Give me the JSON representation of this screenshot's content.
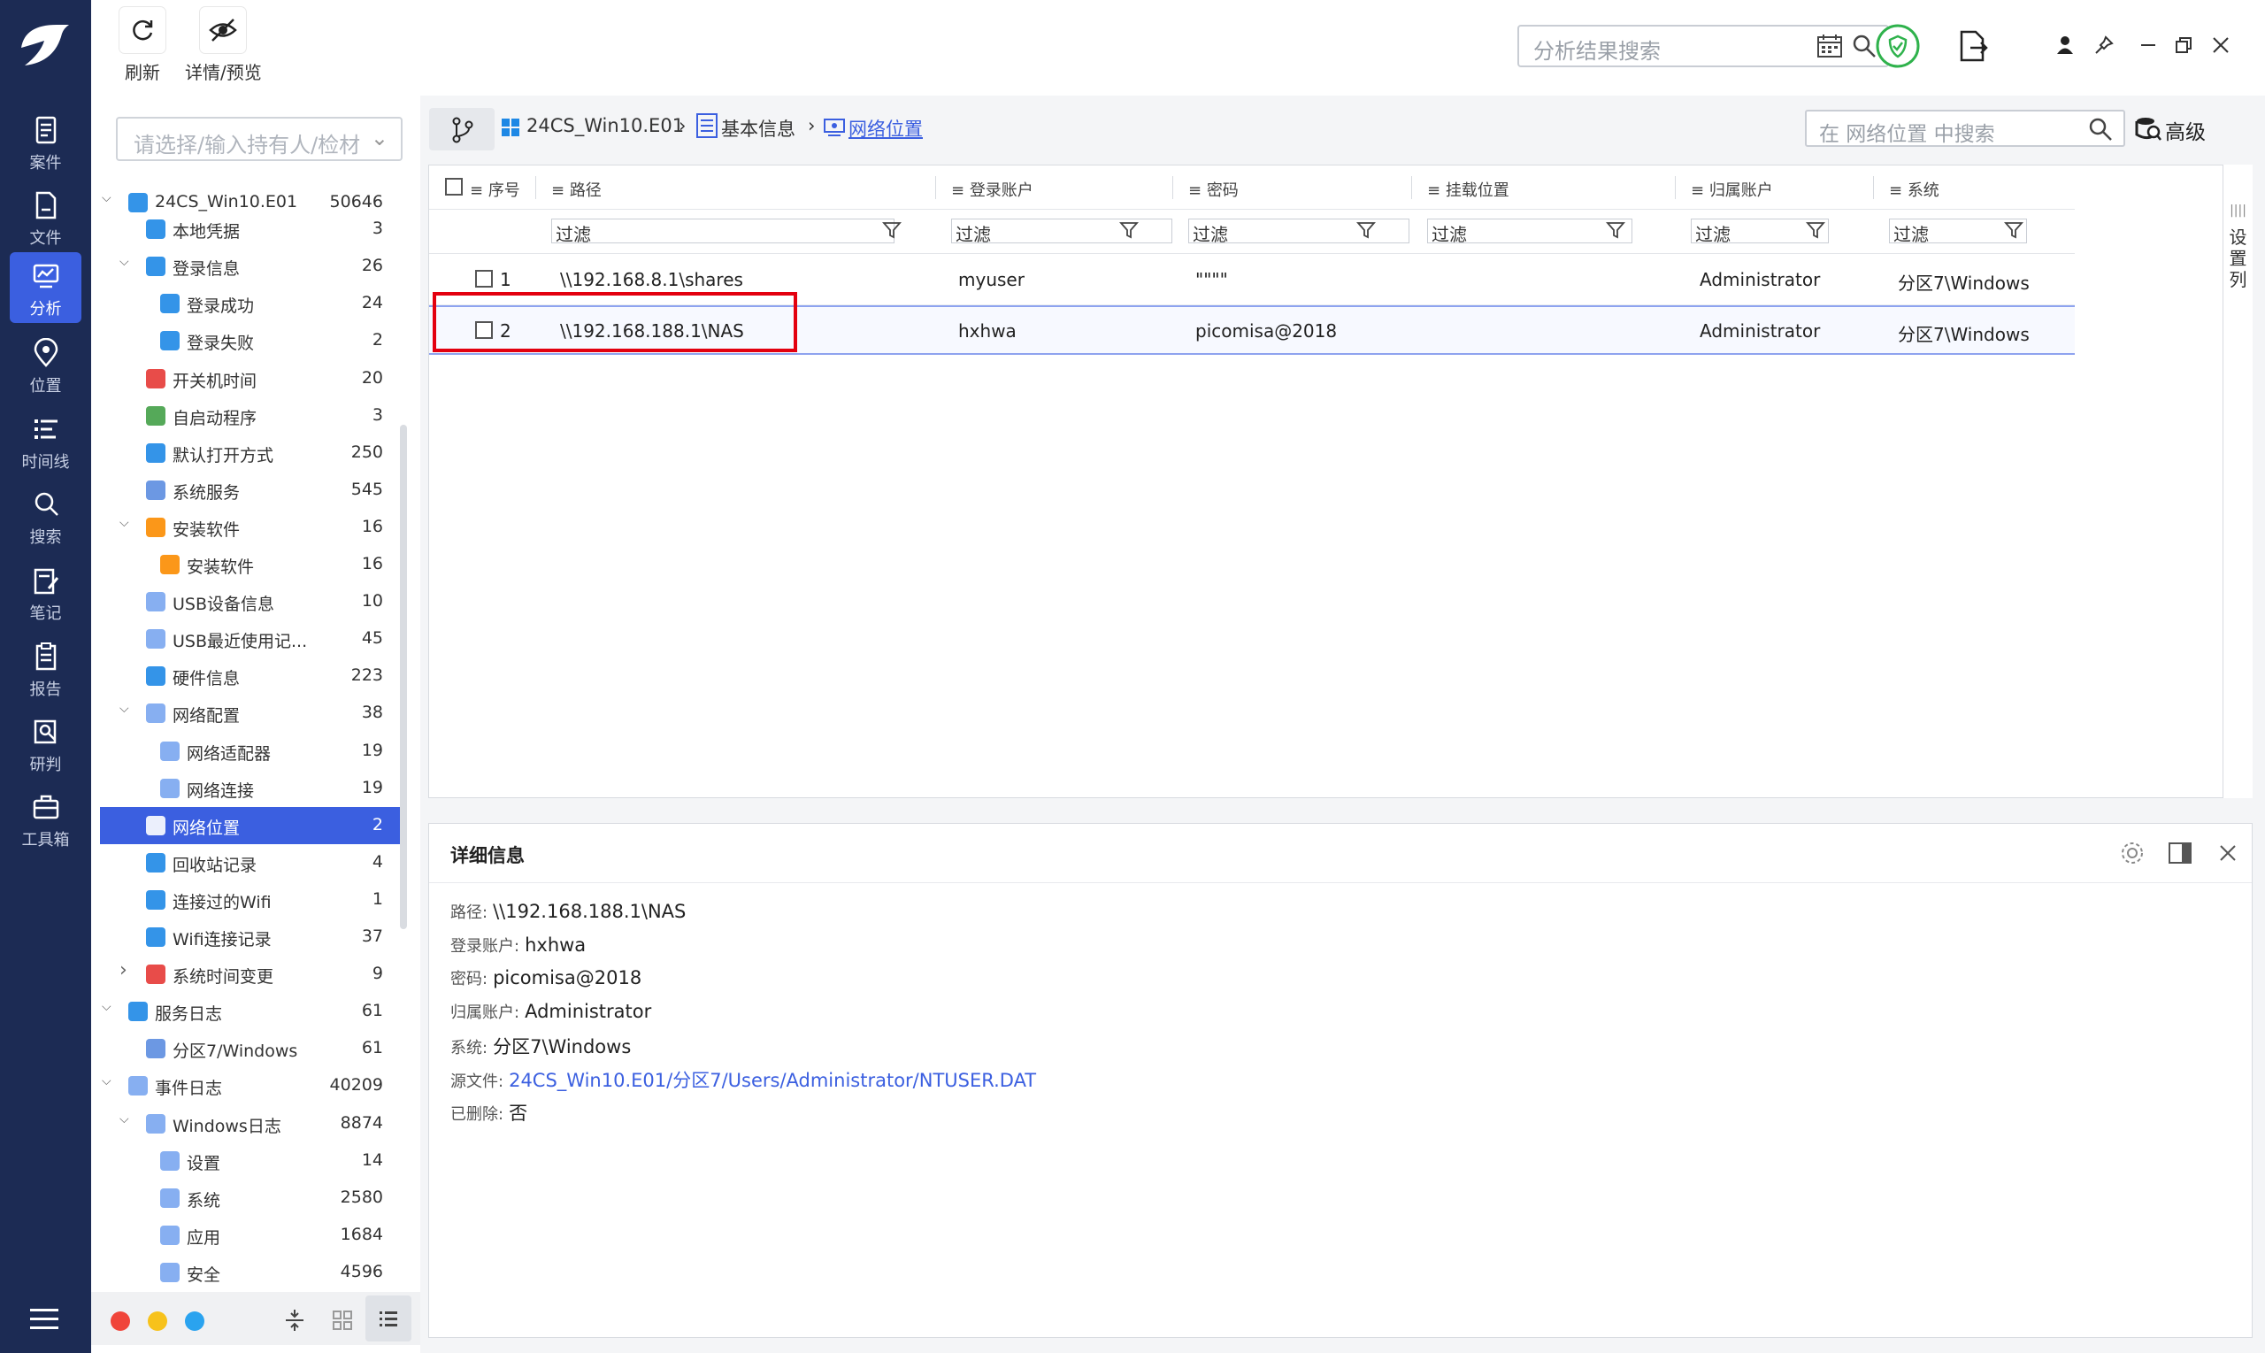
{
  "nav": {
    "items": [
      {
        "label": "案件",
        "icon": "case-icon"
      },
      {
        "label": "文件",
        "icon": "file-icon"
      },
      {
        "label": "分析",
        "icon": "analysis-icon",
        "active": true
      },
      {
        "label": "位置",
        "icon": "location-icon"
      },
      {
        "label": "时间线",
        "icon": "timeline-icon"
      },
      {
        "label": "搜索",
        "icon": "search-icon"
      },
      {
        "label": "笔记",
        "icon": "note-icon"
      },
      {
        "label": "报告",
        "icon": "report-icon"
      },
      {
        "label": "研判",
        "icon": "judge-icon"
      },
      {
        "label": "工具箱",
        "icon": "toolbox-icon"
      }
    ]
  },
  "toolbar": {
    "refresh_label": "刷新",
    "detail_preview_label": "详情/预览",
    "search_placeholder": "分析结果搜索"
  },
  "sidebar": {
    "owner_placeholder": "请选择/输入持有人/检材",
    "tree": [
      {
        "label": "24CS_Win10.E01",
        "count": "50646",
        "level": 0,
        "arrow": "down",
        "icon": "windows-icon",
        "color": "#1e88e5"
      },
      {
        "label": "本地凭据",
        "count": "3",
        "level": 1,
        "arrow": "",
        "icon": "credential-icon",
        "color": "#1e88e5"
      },
      {
        "label": "登录信息",
        "count": "26",
        "level": 1,
        "arrow": "down",
        "icon": "login-icon",
        "color": "#1e88e5"
      },
      {
        "label": "登录成功",
        "count": "24",
        "level": 2,
        "arrow": "",
        "icon": "login-success-icon",
        "color": "#1e88e5"
      },
      {
        "label": "登录失败",
        "count": "2",
        "level": 2,
        "arrow": "",
        "icon": "login-fail-icon",
        "color": "#1e88e5"
      },
      {
        "label": "开关机时间",
        "count": "20",
        "level": 1,
        "arrow": "",
        "icon": "power-icon",
        "color": "#e53935"
      },
      {
        "label": "自启动程序",
        "count": "3",
        "level": 1,
        "arrow": "",
        "icon": "autostart-icon",
        "color": "#43a047"
      },
      {
        "label": "默认打开方式",
        "count": "250",
        "level": 1,
        "arrow": "",
        "icon": "default-open-icon",
        "color": "#1e88e5"
      },
      {
        "label": "系统服务",
        "count": "545",
        "level": 1,
        "arrow": "",
        "icon": "service-icon",
        "color": "#5c8de0"
      },
      {
        "label": "安装软件",
        "count": "16",
        "level": 1,
        "arrow": "down",
        "icon": "install-icon",
        "color": "#fb8c00"
      },
      {
        "label": "安装软件",
        "count": "16",
        "level": 2,
        "arrow": "",
        "icon": "install-icon",
        "color": "#fb8c00"
      },
      {
        "label": "USB设备信息",
        "count": "10",
        "level": 1,
        "arrow": "",
        "icon": "usb-icon",
        "color": "#7aa6f0"
      },
      {
        "label": "USB最近使用记...",
        "count": "45",
        "level": 1,
        "arrow": "",
        "icon": "usb-recent-icon",
        "color": "#7aa6f0"
      },
      {
        "label": "硬件信息",
        "count": "223",
        "level": 1,
        "arrow": "",
        "icon": "hardware-icon",
        "color": "#1e88e5"
      },
      {
        "label": "网络配置",
        "count": "38",
        "level": 1,
        "arrow": "down",
        "icon": "network-config-icon",
        "color": "#7aa6f0"
      },
      {
        "label": "网络适配器",
        "count": "19",
        "level": 2,
        "arrow": "",
        "icon": "adapter-icon",
        "color": "#7aa6f0"
      },
      {
        "label": "网络连接",
        "count": "19",
        "level": 2,
        "arrow": "",
        "icon": "connection-icon",
        "color": "#7aa6f0"
      },
      {
        "label": "网络位置",
        "count": "2",
        "level": 1,
        "arrow": "",
        "icon": "network-location-icon",
        "color": "#ffffff",
        "selected": true
      },
      {
        "label": "回收站记录",
        "count": "4",
        "level": 1,
        "arrow": "",
        "icon": "recycle-bin-icon",
        "color": "#1e88e5"
      },
      {
        "label": "连接过的Wifi",
        "count": "1",
        "level": 1,
        "arrow": "",
        "icon": "wifi-icon",
        "color": "#1e88e5"
      },
      {
        "label": "Wifi连接记录",
        "count": "37",
        "level": 1,
        "arrow": "",
        "icon": "wifi-record-icon",
        "color": "#1e88e5"
      },
      {
        "label": "系统时间变更",
        "count": "9",
        "level": 1,
        "arrow": "right",
        "icon": "clock-icon",
        "color": "#e53935"
      },
      {
        "label": "服务日志",
        "count": "61",
        "level": 0,
        "arrow": "down",
        "icon": "service-log-icon",
        "color": "#1e88e5"
      },
      {
        "label": "分区7/Windows",
        "count": "61",
        "level": 1,
        "arrow": "",
        "icon": "service-icon",
        "color": "#5c8de0"
      },
      {
        "label": "事件日志",
        "count": "40209",
        "level": 0,
        "arrow": "down",
        "icon": "event-log-icon",
        "color": "#7aa6f0"
      },
      {
        "label": "Windows日志",
        "count": "8874",
        "level": 1,
        "arrow": "down",
        "icon": "windows-log-icon",
        "color": "#7aa6f0"
      },
      {
        "label": "设置",
        "count": "14",
        "level": 2,
        "arrow": "",
        "icon": "log-setting-icon",
        "color": "#7aa6f0"
      },
      {
        "label": "系统",
        "count": "2580",
        "level": 2,
        "arrow": "",
        "icon": "log-system-icon",
        "color": "#7aa6f0"
      },
      {
        "label": "应用",
        "count": "1684",
        "level": 2,
        "arrow": "",
        "icon": "log-app-icon",
        "color": "#7aa6f0"
      },
      {
        "label": "安全",
        "count": "4596",
        "level": 2,
        "arrow": "",
        "icon": "log-security-icon",
        "color": "#7aa6f0"
      }
    ]
  },
  "breadcrumb": {
    "evidence": "24CS_Win10.E01",
    "basic_info": "基本信息",
    "current": "网络位置",
    "search_placeholder": "在 网络位置 中搜索",
    "advanced_label": "高级"
  },
  "table": {
    "headers": [
      "序号",
      "路径",
      "登录账户",
      "密码",
      "挂载位置",
      "归属账户",
      "系统"
    ],
    "filter_placeholder": "过滤",
    "rows": [
      {
        "index": "1",
        "path": "\\\\192.168.8.1\\shares",
        "account": "myuser",
        "password": "\"\"\"\"",
        "mount": "",
        "owner": "Administrator",
        "system": "分区7\\Windows"
      },
      {
        "index": "2",
        "path": "\\\\192.168.188.1\\NAS",
        "account": "hxhwa",
        "password": "picomisa@2018",
        "mount": "",
        "owner": "Administrator",
        "system": "分区7\\Windows",
        "selected": true
      }
    ],
    "column_settings_label": "设置列"
  },
  "details": {
    "title": "详细信息",
    "fields": [
      {
        "key": "路径:",
        "value": "\\\\192.168.188.1\\NAS"
      },
      {
        "key": "登录账户:",
        "value": "hxhwa"
      },
      {
        "key": "密码:",
        "value": "picomisa@2018"
      },
      {
        "key": "归属账户:",
        "value": "Administrator"
      },
      {
        "key": "系统:",
        "value": "分区7\\Windows"
      },
      {
        "key": "源文件:",
        "value": "24CS_Win10.E01/分区7/Users/Administrator/NTUSER.DAT",
        "link": true
      },
      {
        "key": "已删除:",
        "value": "否"
      }
    ]
  },
  "colors": {
    "nav_bg": "#1c2b54",
    "accent": "#3b5fe0",
    "highlight_box": "#e3000f"
  }
}
